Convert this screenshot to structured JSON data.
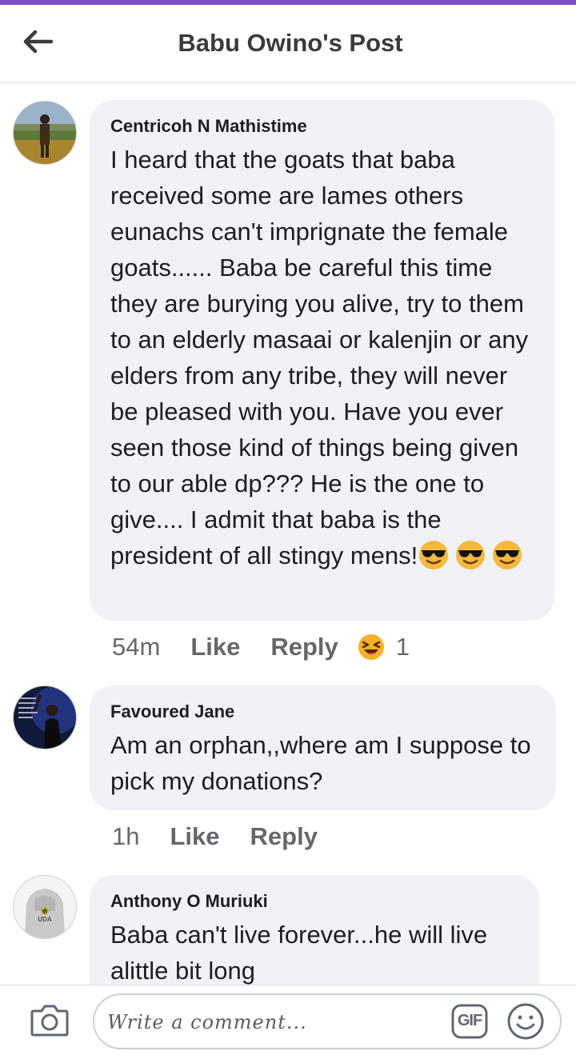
{
  "header": {
    "title": "Babu Owino's Post",
    "back_icon": "arrow-left-icon"
  },
  "comments": [
    {
      "author": "Centricoh N Mathistime",
      "text": "I heard that the goats that baba received some are lames others eunachs can't imprignate the female goats...... Baba be careful this time they are burying you alive, try to them to an elderly masaai or kalenjin or any elders from any tribe, they will never be pleased with you. Have you ever seen those kind of things being given to our able dp??? He is the one to give.... I admit that baba is the president of all stingy mens!",
      "emojis": [
        "smiling-face-with-sunglasses",
        "smiling-face-with-sunglasses",
        "smiling-face-with-sunglasses"
      ],
      "time": "54m",
      "like_label": "Like",
      "reply_label": "Reply",
      "reaction_icon": "laughing-squinting-face",
      "reaction_count": "1"
    },
    {
      "author": "Favoured Jane",
      "text": "Am an orphan,,where am I suppose to pick my donations?",
      "time": "1h",
      "like_label": "Like",
      "reply_label": "Reply"
    },
    {
      "author": "Anthony O Muriuki",
      "text": "Baba can't live forever...he will live alittle bit long",
      "avatar_badge": "UDA"
    }
  ],
  "composer": {
    "placeholder": "Write a comment...",
    "camera_icon": "camera-icon",
    "gif_label": "GIF",
    "emoji_icon": "smiley-icon"
  },
  "colors": {
    "accent": "#7b4fc2",
    "bubble": "#f0f2f5",
    "meta_text": "#65676b"
  }
}
